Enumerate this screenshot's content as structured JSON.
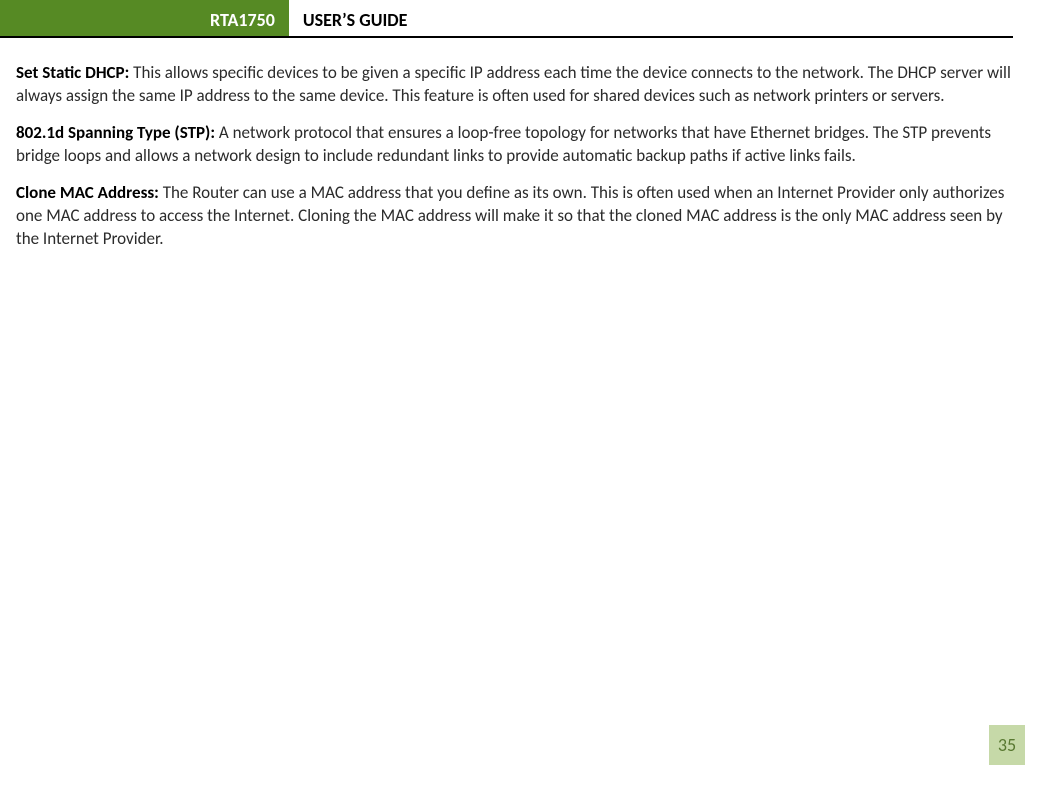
{
  "header": {
    "model": "RTA1750",
    "title": "USER’S GUIDE"
  },
  "paragraphs": [
    {
      "term": "Set Static DHCP:",
      "body": " This allows specific devices to be given a specific IP address each time the device connects to the network. The DHCP server will always assign the same IP address to the same device. This feature is often used for shared devices such as network printers or servers."
    },
    {
      "term": "802.1d Spanning Type (STP):",
      "body": " A network protocol that ensures a loop-free topology for networks that have Ethernet bridges. The STP prevents bridge loops and allows a network design to include redundant links to provide automatic backup paths if active links fails."
    },
    {
      "term": "Clone MAC Address:",
      "body": " The Router can use a MAC address that you define as its own. This is often used when an Internet Provider only authorizes one MAC address to access the Internet. Cloning the MAC address will make it so that the cloned MAC address is the only MAC address seen by the Internet Provider."
    }
  ],
  "page_number": "35"
}
